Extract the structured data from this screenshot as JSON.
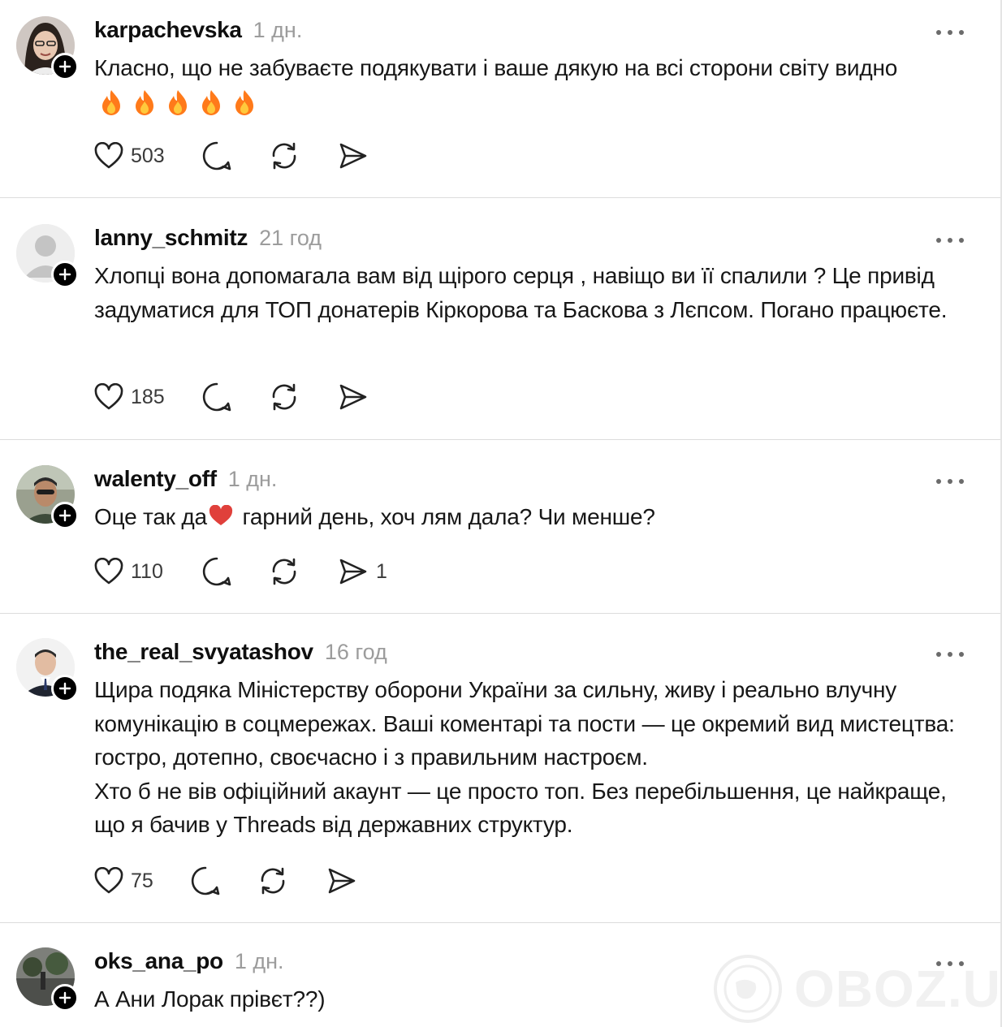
{
  "posts": [
    {
      "username": "karpachevska",
      "time": "1 дн.",
      "text": "Класно, що не забуваєте подякувати і ваше дякую на всі сторони світу видно",
      "emoji": "🔥🔥🔥🔥🔥",
      "likes": "503",
      "reply_count": "",
      "repost_count": "",
      "share_count": "",
      "avatar_icon": "user-photo"
    },
    {
      "username": "lanny_schmitz",
      "time": "21 год",
      "text": "Хлопці вона допомагала вам від щірого серця , навіщо ви її спалили ? Це привід задуматися для ТОП донатерів Кіркорова та Баскова з Лєпсом. Погано працюєте.",
      "likes": "185",
      "reply_count": "",
      "repost_count": "",
      "share_count": "",
      "avatar_icon": "default-user-icon"
    },
    {
      "username": "walenty_off",
      "time": "1 дн.",
      "text_before": "Оце так да",
      "text_emoji": "❤️",
      "text_after": " гарний день, хоч лям дала? Чи менше?",
      "likes": "110",
      "reply_count": "",
      "repost_count": "",
      "share_count": "1",
      "avatar_icon": "user-photo"
    },
    {
      "username": "the_real_svyatashov",
      "time": "16 год",
      "text_lines": [
        "Щира подяка Міністерству оборони України за сильну, живу і реально влучну комунікацію в соцмережах. Ваші коментарі та пости — це окремий вид мистецтва: гостро, дотепно, своєчасно і з правильним настроєм.",
        "Хто б не вів офіційний акаунт — це просто топ. Без перебільшення, це найкраще, що я бачив у Threads від державних структур."
      ],
      "likes": "75",
      "reply_count": "",
      "repost_count": "",
      "share_count": "",
      "avatar_icon": "user-photo"
    },
    {
      "username": "oks_ana_po",
      "time": "1 дн.",
      "text": "А Ани Лорак прівєт??)",
      "avatar_icon": "user-photo"
    }
  ],
  "watermark": {
    "text": "OBOZ.UA",
    "icon": "globe-icon"
  },
  "colors": {
    "text": "#171717",
    "muted": "#9c9c9c",
    "divider": "#dcdcdc",
    "fire": "#ff7a1a",
    "heart": "#e0403b"
  }
}
